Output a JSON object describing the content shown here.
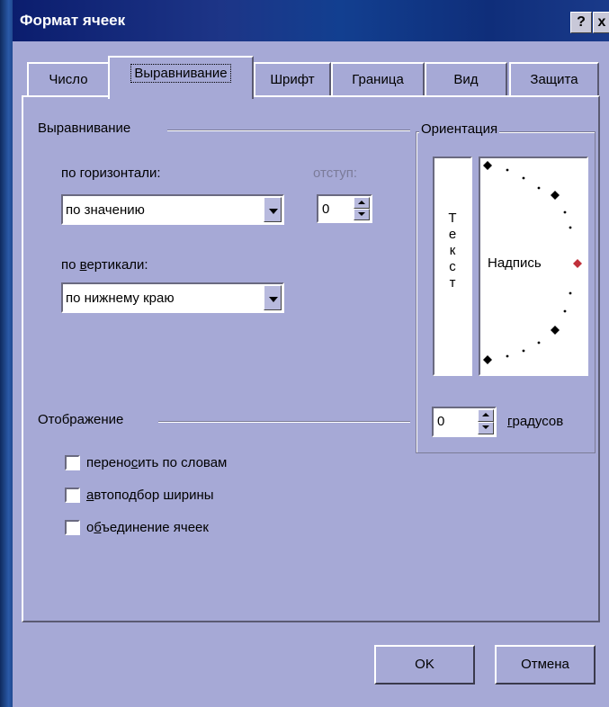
{
  "window": {
    "title": "Формат ячеек",
    "help_label": "?",
    "close_label": "x"
  },
  "tabs": [
    {
      "label": "Число"
    },
    {
      "label": "Выравнивание",
      "active": true
    },
    {
      "label": "Шрифт"
    },
    {
      "label": "Граница"
    },
    {
      "label": "Вид"
    },
    {
      "label": "Защита"
    }
  ],
  "alignment": {
    "group_label": "Выравнивание",
    "horizontal_label": "по горизонтали:",
    "horizontal_value": "по значению",
    "indent_label": "отступ:",
    "indent_value": "0",
    "vertical_label": "по вертикали:",
    "vertical_value": "по нижнему краю"
  },
  "orientation": {
    "group_label": "Ориентация",
    "vertical_text": [
      "Т",
      "е",
      "к",
      "с",
      "т"
    ],
    "dial_label": "Надпись",
    "degrees_value": "0",
    "degrees_label": "градусов"
  },
  "display": {
    "group_label": "Отображение",
    "wrap_text": "переносить по словам",
    "shrink_to_fit": "автоподбор ширины",
    "merge_cells": "объединение ячеек"
  },
  "buttons": {
    "ok": "OK",
    "cancel": "Отмена"
  },
  "colors": {
    "title_bar": "#0b1d6e",
    "dialog_bg": "#a6a9d6",
    "dial_marker": "#c0303a"
  }
}
